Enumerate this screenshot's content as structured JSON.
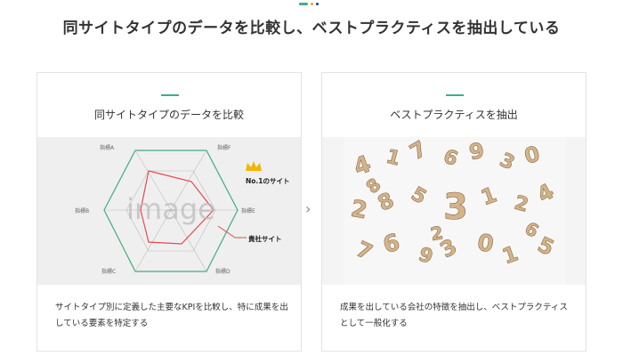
{
  "headline": "同サイトタイプのデータを比較し、ベストプラクティスを抽出している",
  "cards": [
    {
      "title": "同サイトタイプのデータを比較",
      "description": "サイトタイプ別に定義した主要なKPIを比較し、特に成果を出している要素を特定する",
      "radar": {
        "axes": [
          "指標A",
          "指標F",
          "指標E",
          "指標D",
          "指標C",
          "指標B"
        ],
        "placeholder": "image",
        "series": [
          {
            "name": "No.1のサイト",
            "color": "#3fae7d"
          },
          {
            "name": "貴社サイト",
            "color": "#e8484f"
          }
        ],
        "crown_color": "#f2b600"
      }
    },
    {
      "title": "ベストプラクティスを抽出",
      "description": "成果を出している会社の特徴を抽出し、ベストプラクティスとして一般化する",
      "numbers": [
        "4",
        "1",
        "7",
        "6",
        "9",
        "3",
        "0",
        "2",
        "8",
        "5",
        "3",
        "1",
        "2",
        "4",
        "7",
        "6",
        "9",
        "3",
        "0",
        "1",
        "5",
        "8",
        "6",
        "2"
      ]
    }
  ],
  "arrow_icon": "chevron-right-icon",
  "colors": {
    "accent_green": "#3fae7d",
    "accent_red": "#e8484f",
    "accent_gold": "#f2b600",
    "wood": "#d4b48a"
  }
}
